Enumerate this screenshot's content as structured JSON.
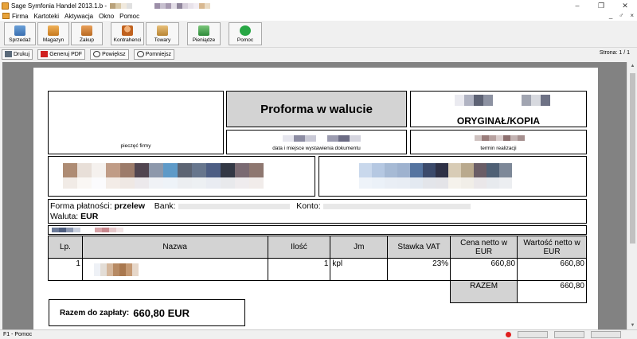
{
  "window": {
    "title": "Sage Symfonia Handel 2013.1.b -",
    "controls": [
      "–",
      "❐",
      "✕"
    ]
  },
  "menu": {
    "items": [
      "Firma",
      "Kartoteki",
      "Aktywacja",
      "Okno",
      "Pomoc"
    ],
    "right": [
      "_",
      "♂",
      "×"
    ]
  },
  "toolbar": {
    "buttons": [
      {
        "label": "Sprzedaż",
        "icon": "sales-icon"
      },
      {
        "label": "Magazyn",
        "icon": "warehouse-icon"
      },
      {
        "label": "Zakup",
        "icon": "purchase-icon"
      },
      {
        "label": "Kontrahenci",
        "icon": "contractors-icon"
      },
      {
        "label": "Towary",
        "icon": "goods-icon"
      },
      {
        "label": "Pieniądze",
        "icon": "money-icon"
      },
      {
        "label": "Pomoc",
        "icon": "help-icon"
      }
    ]
  },
  "preview_toolbar": {
    "print": "Drukuj",
    "pdf": "Generuj PDF",
    "zoom_in": "Powiększ",
    "zoom_out": "Pomniejsz",
    "page_label": "Strona: 1 / 1"
  },
  "document": {
    "stamp_label": "pieczęć firmy",
    "doc_title": "Proforma w walucie",
    "original_copy": "ORYGINAŁ/KOPIA",
    "date_place_label": "data i miejsce wystawienia dokumentu",
    "realization_label": "termin realizacji",
    "payment_prefix": "Forma płatności:",
    "payment_value": "przelew",
    "bank_label": "Bank:",
    "account_label": "Konto:",
    "currency_prefix": "Waluta:",
    "currency_value": "EUR",
    "table": {
      "headers": [
        "Lp.",
        "Nazwa",
        "Ilość",
        "Jm",
        "Stawka VAT",
        "Cena netto w EUR",
        "Wartość netto w EUR"
      ],
      "rows": [
        {
          "lp": "1",
          "qty": "1",
          "unit": "kpl",
          "vat": "23%",
          "price": "660,80",
          "value": "660,80"
        }
      ],
      "sum_label": "RAZEM",
      "sum_value": "660,80"
    },
    "total_label": "Razem do zapłaty:",
    "total_value": "660,80 EUR"
  },
  "status": {
    "text": "F1 - Pomoc"
  },
  "colors": {
    "title_box_bg": "#d3d3d3",
    "preview_bg": "#828282"
  }
}
